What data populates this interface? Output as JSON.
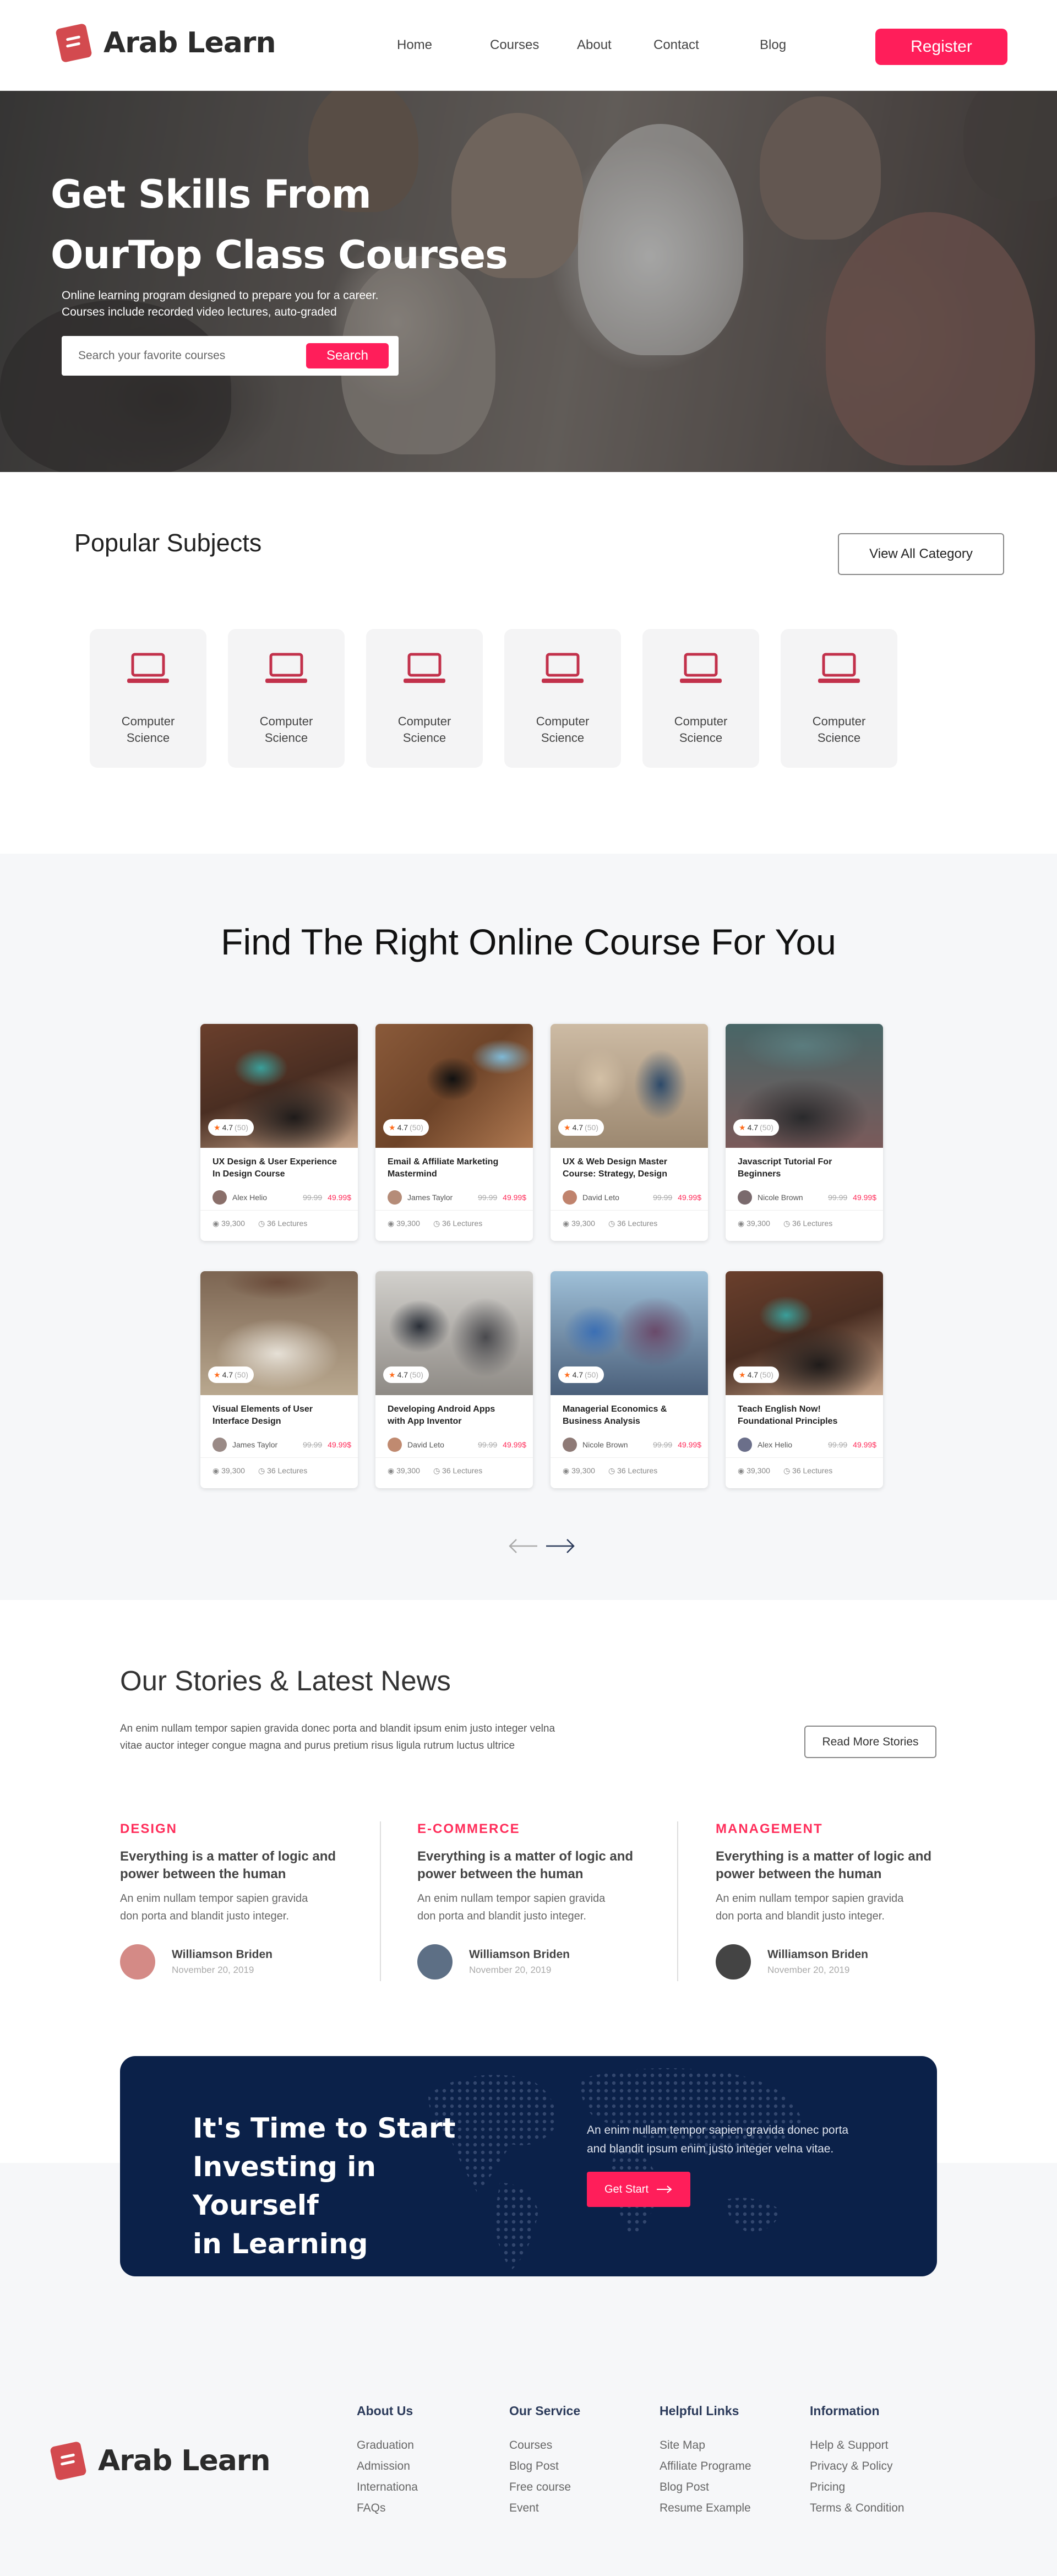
{
  "header": {
    "brand": "Arab Learn",
    "nav": [
      "Home",
      "Courses",
      "About",
      "Contact",
      "Blog"
    ],
    "register_label": "Register"
  },
  "hero": {
    "title_line1": "Get Skills From",
    "title_line2": "OurTop Class Courses",
    "subtitle_line1": "Online learning program designed to prepare you for a career.",
    "subtitle_line2": "Courses include recorded video lectures, auto-graded",
    "search_placeholder": "Search your favorite courses",
    "search_label": "Search"
  },
  "popular": {
    "title": "Popular Subjects",
    "view_all_label": "View All Category",
    "subjects": [
      {
        "line1": "Computer",
        "line2": "Science",
        "icon": "laptop-icon"
      },
      {
        "line1": "Computer",
        "line2": "Science",
        "icon": "laptop-icon"
      },
      {
        "line1": "Computer",
        "line2": "Science",
        "icon": "laptop-icon"
      },
      {
        "line1": "Computer",
        "line2": "Science",
        "icon": "laptop-icon"
      },
      {
        "line1": "Computer",
        "line2": "Science",
        "icon": "laptop-icon"
      },
      {
        "line1": "Computer",
        "line2": "Science",
        "icon": "laptop-icon"
      }
    ],
    "icon_color": "#c2314b"
  },
  "courses": {
    "title": "Find The Right Online Course For You",
    "items": [
      {
        "rating": "4.7",
        "count": "(50)",
        "title_line1": "UX Design & User Experience",
        "title_line2": "In Design Course",
        "instructor": "Alex Helio",
        "old_price": "99.99",
        "price": "49.99$",
        "students": "39,300",
        "lectures": "36 Lectures"
      },
      {
        "rating": "4.7",
        "count": "(50)",
        "title_line1": "Email & Affiliate Marketing",
        "title_line2": "Mastermind",
        "instructor": "James Taylor",
        "old_price": "99.99",
        "price": "49.99$",
        "students": "39,300",
        "lectures": "36 Lectures"
      },
      {
        "rating": "4.7",
        "count": "(50)",
        "title_line1": "UX & Web Design Master",
        "title_line2": "Course: Strategy, Design",
        "instructor": "David Leto",
        "old_price": "99.99",
        "price": "49.99$",
        "students": "39,300",
        "lectures": "36 Lectures"
      },
      {
        "rating": "4.7",
        "count": "(50)",
        "title_line1": "Javascript Tutorial For",
        "title_line2": "Beginners",
        "instructor": "Nicole Brown",
        "old_price": "99.99",
        "price": "49.99$",
        "students": "39,300",
        "lectures": "36 Lectures"
      },
      {
        "rating": "4.7",
        "count": "(50)",
        "title_line1": "Visual Elements of User",
        "title_line2": "Interface Design",
        "instructor": "James Taylor",
        "old_price": "99.99",
        "price": "49.99$",
        "students": "39,300",
        "lectures": "36 Lectures"
      },
      {
        "rating": "4.7",
        "count": "(50)",
        "title_line1": "Developing Android Apps",
        "title_line2": "with App Inventor",
        "instructor": "David Leto",
        "old_price": "99.99",
        "price": "49.99$",
        "students": "39,300",
        "lectures": "36 Lectures"
      },
      {
        "rating": "4.7",
        "count": "(50)",
        "title_line1": "Managerial Economics &",
        "title_line2": "Business Analysis",
        "instructor": "Nicole Brown",
        "old_price": "99.99",
        "price": "49.99$",
        "students": "39,300",
        "lectures": "36 Lectures"
      },
      {
        "rating": "4.7",
        "count": "(50)",
        "title_line1": "Teach English Now!",
        "title_line2": "Foundational Principles",
        "instructor": "Alex Helio",
        "old_price": "99.99",
        "price": "49.99$",
        "students": "39,300",
        "lectures": "36 Lectures"
      }
    ],
    "prev_icon": "arrow-left-icon",
    "next_icon": "arrow-right-icon"
  },
  "stories": {
    "title": "Our Stories & Latest News",
    "desc_line1": "An enim nullam tempor sapien gravida donec porta and blandit ipsum enim justo integer velna",
    "desc_line2": "vitae auctor integer congue magna and purus pretium risus ligula rutrum luctus ultrice",
    "read_more_label": "Read More Stories",
    "items": [
      {
        "category": "DESIGN",
        "title_line1": "Everything is a matter of logic and",
        "title_line2": "power between the human",
        "desc_line1": "An enim nullam tempor sapien gravida",
        "desc_line2": "don porta and blandit justo integer.",
        "author": "Williamson Briden",
        "date": "November 20, 2019"
      },
      {
        "category": "E-COMMERCE",
        "title_line1": "Everything is a matter of logic and",
        "title_line2": "power between the human",
        "desc_line1": "An enim nullam tempor sapien gravida",
        "desc_line2": "don porta and blandit justo integer.",
        "author": "Williamson Briden",
        "date": "November 20, 2019"
      },
      {
        "category": "MANAGEMENT",
        "title_line1": "Everything is a matter of logic and",
        "title_line2": "power between the human",
        "desc_line1": "An enim nullam tempor sapien gravida",
        "desc_line2": "don porta and blandit justo integer.",
        "author": "Williamson Briden",
        "date": "November 20, 2019"
      }
    ]
  },
  "cta": {
    "title_line1": "It's Time to Start",
    "title_line2": "Investing in Yourself",
    "title_line3": "in Learning",
    "desc_line1": "An enim nullam tempor sapien gravida donec porta",
    "desc_line2": "and blandit ipsum enim justo integer velna vitae.",
    "button_label": "Get Start"
  },
  "footer": {
    "brand": "Arab Learn",
    "columns": [
      {
        "heading": "About Us",
        "links": [
          "Graduation",
          "Admission",
          "Internationa",
          "FAQs"
        ]
      },
      {
        "heading": "Our Service",
        "links": [
          "Courses",
          "Blog Post",
          "Free course",
          "Event"
        ]
      },
      {
        "heading": "Helpful Links",
        "links": [
          "Site Map",
          "Affiliate Programe",
          "Blog Post",
          "Resume Example"
        ]
      },
      {
        "heading": "Information",
        "links": [
          "Help & Support",
          "Privacy & Policy",
          "Pricing",
          "Terms & Condition"
        ]
      }
    ]
  },
  "colors": {
    "accent": "#ff1e5a",
    "navy": "#0b2149",
    "brand_icon": "#d34a4f"
  }
}
